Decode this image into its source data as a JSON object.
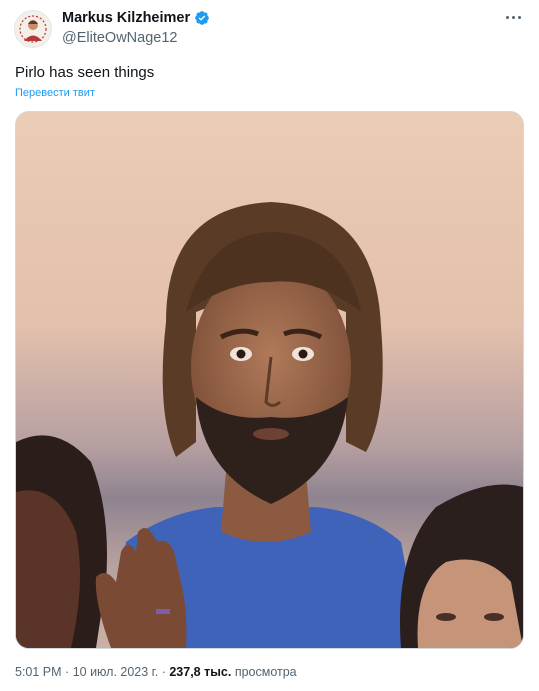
{
  "author": {
    "name": "Markus Kilzheimer",
    "handle": "@EliteOwNage12",
    "verified": true
  },
  "tweet": {
    "text": "Pirlo has seen things",
    "translate_label": "Перевести твит"
  },
  "meta": {
    "time": "5:01 PM",
    "date": "10 июл. 2023 г.",
    "views_count": "237,8 тыс.",
    "views_label": "просмотра",
    "separator": "·"
  },
  "icons": {
    "verified": "verified-badge-icon",
    "more": "more-options-icon"
  },
  "colors": {
    "accent": "#1d9bf0",
    "secondary_text": "#536471",
    "primary_text": "#0f1419"
  }
}
